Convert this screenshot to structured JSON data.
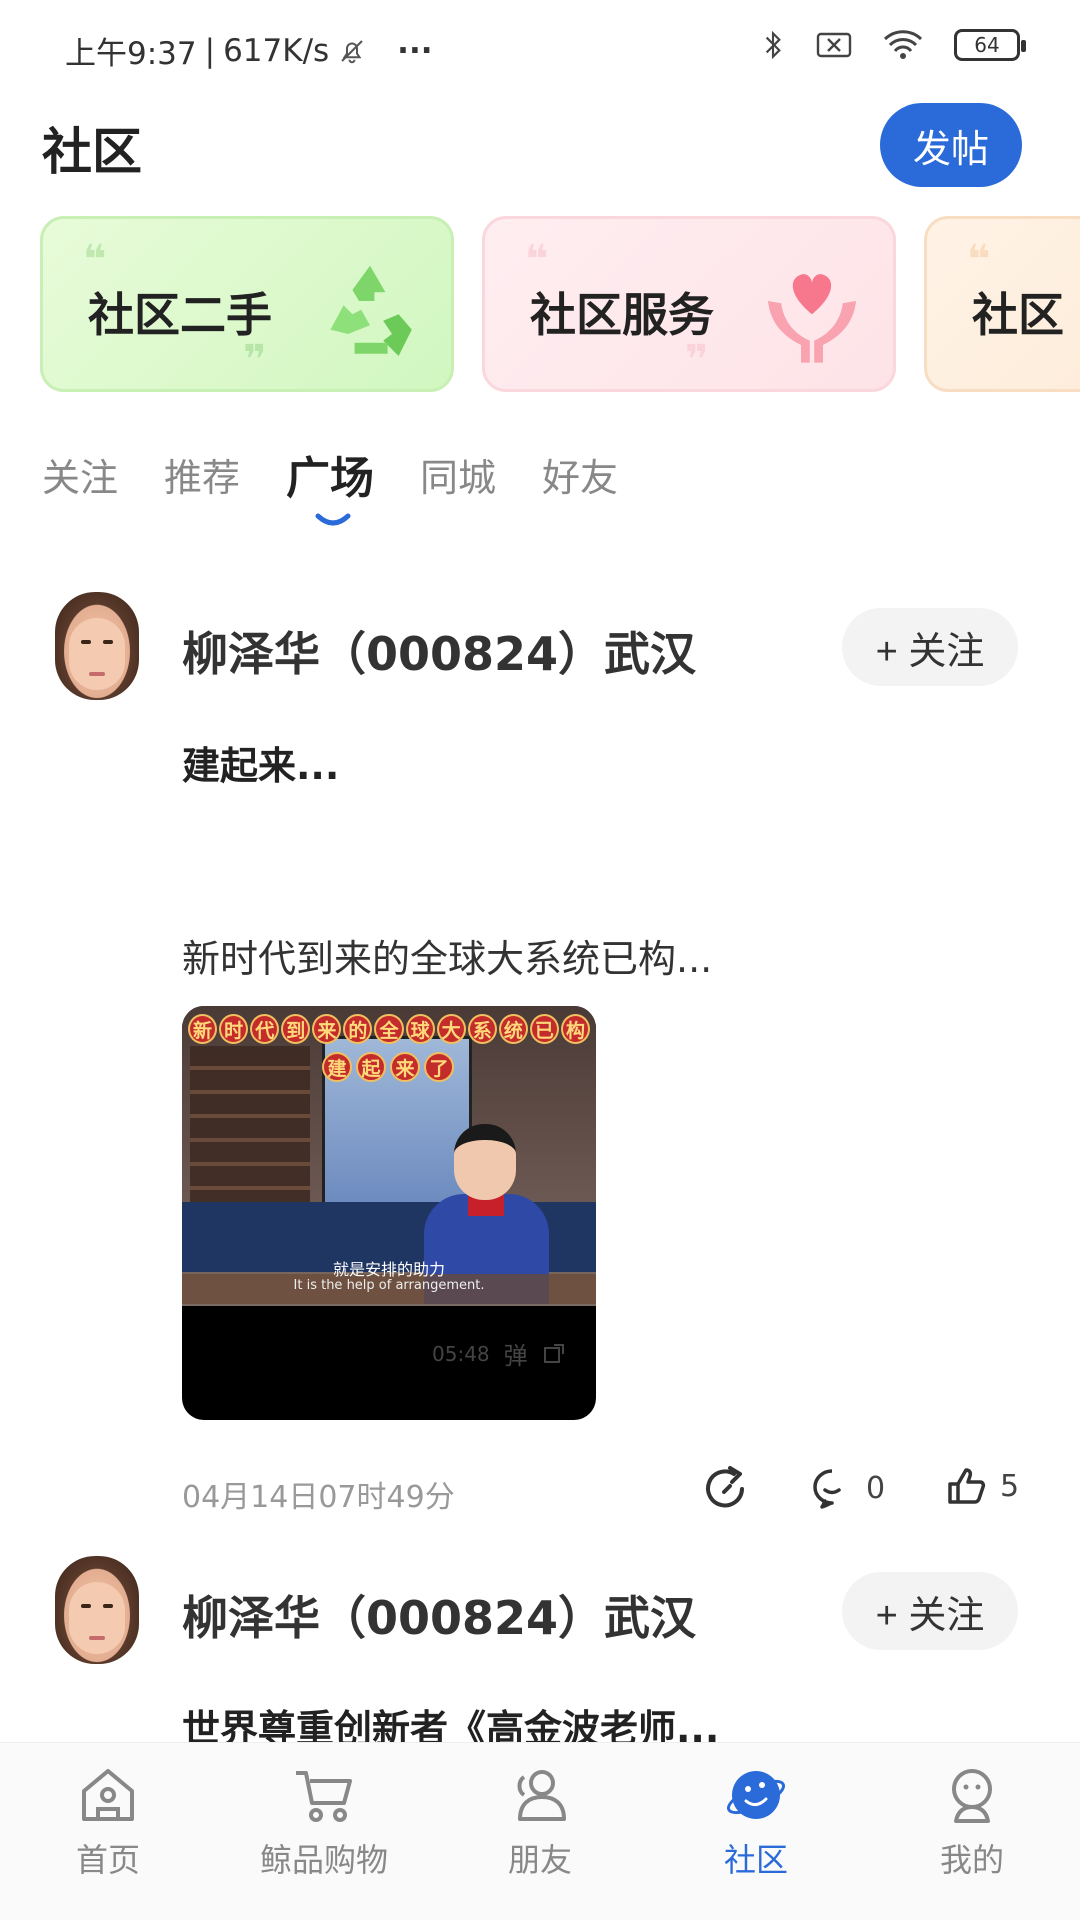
{
  "status_bar": {
    "time": "上午9:37",
    "speed": "617K/s",
    "more": "···",
    "battery": "64"
  },
  "header": {
    "title": "社区",
    "post_button": "发帖"
  },
  "categories": [
    {
      "label": "社区二手",
      "icon": "recycle-icon"
    },
    {
      "label": "社区服务",
      "icon": "heart-hands-icon"
    },
    {
      "label": "社区"
    }
  ],
  "tabs": [
    {
      "label": "关注"
    },
    {
      "label": "推荐"
    },
    {
      "label": "广场",
      "active": true
    },
    {
      "label": "同城"
    },
    {
      "label": "好友"
    }
  ],
  "posts": [
    {
      "author": "柳泽华（000824）武汉",
      "follow_label": "+ 关注",
      "title": "建起来...",
      "body": "新时代到来的全球大系统已构...",
      "media": {
        "banner_chars": [
          "新",
          "时",
          "代",
          "到",
          "来",
          "的",
          "全",
          "球",
          "大",
          "系",
          "统",
          "已",
          "构"
        ],
        "banner2_chars": [
          "建",
          "起",
          "来",
          "了"
        ],
        "subtitle_cn": "就是安排的助力",
        "subtitle_en": "It is the help of arrangement.",
        "duration": "05:48",
        "danmu": "弹"
      },
      "timestamp": "04月14日07时49分",
      "comments": "0",
      "likes": "5"
    },
    {
      "author": "柳泽华（000824）武汉",
      "follow_label": "+ 关注",
      "title": "世界尊重创新者《高金波老师..."
    }
  ],
  "bottom_nav": [
    {
      "label": "首页",
      "icon": "home-icon"
    },
    {
      "label": "鲸品购物",
      "icon": "cart-icon"
    },
    {
      "label": "朋友",
      "icon": "friends-icon"
    },
    {
      "label": "社区",
      "icon": "community-planet-icon",
      "active": true
    },
    {
      "label": "我的",
      "icon": "profile-icon"
    }
  ],
  "colors": {
    "accent": "#2a6bd9",
    "text": "#222222",
    "muted": "#888888"
  }
}
